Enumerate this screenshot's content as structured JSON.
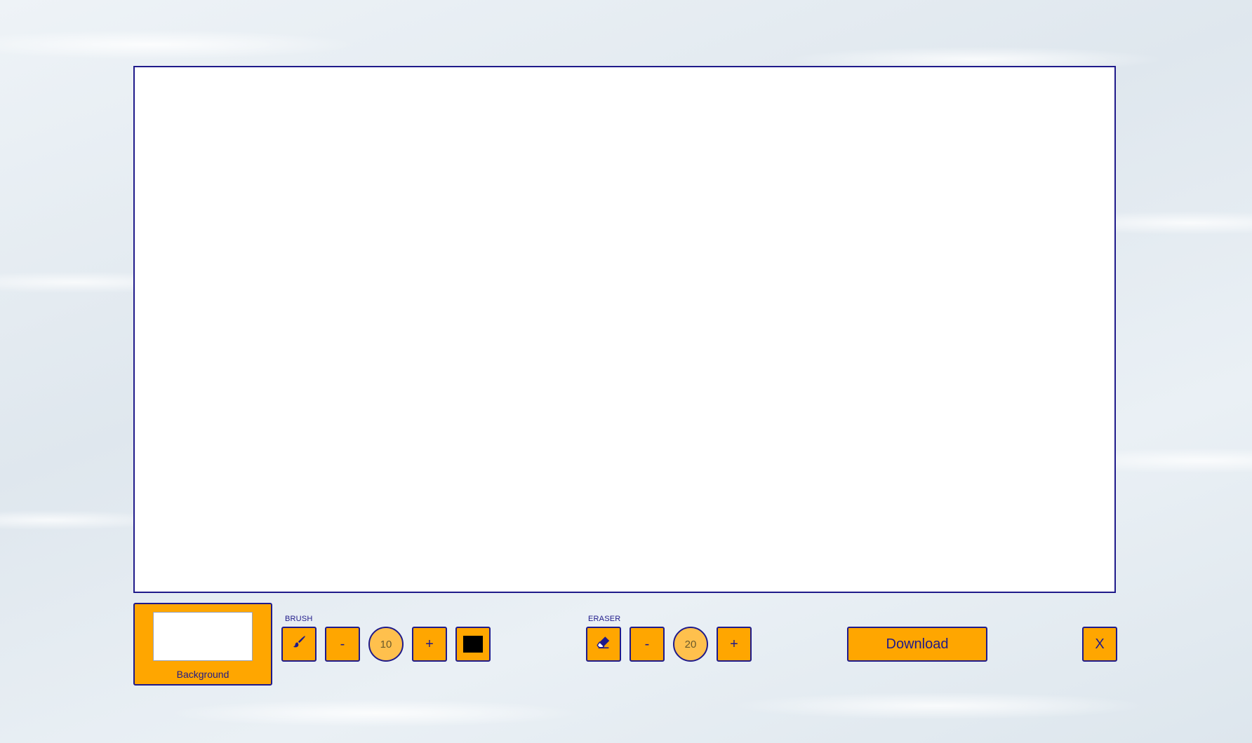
{
  "canvas": {
    "background_color": "#ffffff"
  },
  "background": {
    "label": "Background",
    "color": "#ffffff"
  },
  "brush": {
    "label": "BRUSH",
    "icon": "paintbrush-icon",
    "decrease_label": "-",
    "size": "10",
    "increase_label": "+",
    "color": "#000000"
  },
  "eraser": {
    "label": "ERASER",
    "icon": "eraser-icon",
    "decrease_label": "-",
    "size": "20",
    "increase_label": "+"
  },
  "actions": {
    "download_label": "Download",
    "close_label": "X"
  },
  "colors": {
    "accent": "#ffa600",
    "border": "#1f1a8a",
    "size_fill": "#ffc04d"
  }
}
